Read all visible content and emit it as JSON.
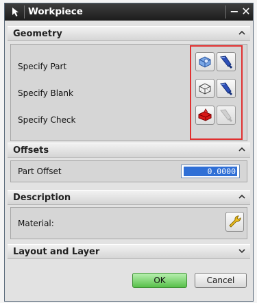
{
  "window": {
    "title": "Workpiece",
    "minimize_glyph": "−",
    "close_glyph": "✕"
  },
  "sections": {
    "geometry": {
      "label": "Geometry",
      "state": "expanded",
      "rows": [
        {
          "label": "Specify Part",
          "select_icon": "part-geometry-icon",
          "display_icon": "flashlight-icon",
          "display_enabled": true
        },
        {
          "label": "Specify Blank",
          "select_icon": "blank-geometry-icon",
          "display_icon": "flashlight-icon",
          "display_enabled": true
        },
        {
          "label": "Specify Check",
          "select_icon": "check-geometry-icon",
          "display_icon": "flashlight-icon",
          "display_enabled": false
        }
      ]
    },
    "offsets": {
      "label": "Offsets",
      "state": "expanded",
      "part_offset_label": "Part Offset",
      "part_offset_value": "0.0000"
    },
    "description": {
      "label": "Description",
      "state": "expanded",
      "material_label": "Material:",
      "material_icon": "wrench-icon"
    },
    "layout_and_layer": {
      "label": "Layout and Layer",
      "state": "collapsed"
    }
  },
  "buttons": {
    "ok": "OK",
    "cancel": "Cancel"
  },
  "colors": {
    "titlebar": "#2a2a2a",
    "highlight_box": "#e03030",
    "ok_button": "#58c04a",
    "selected_value_bg": "#2f6fd6"
  }
}
